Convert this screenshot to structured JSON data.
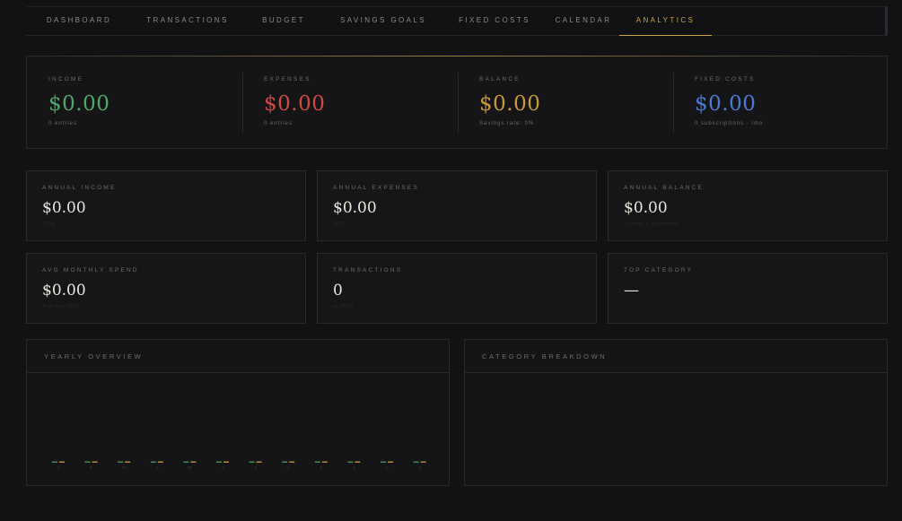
{
  "tabs": [
    {
      "label": "DASHBOARD"
    },
    {
      "label": "TRANSACTIONS"
    },
    {
      "label": "BUDGET"
    },
    {
      "label": "SAVINGS GOALS"
    },
    {
      "label": "FIXED COSTS"
    },
    {
      "label": "CALENDAR"
    },
    {
      "label": "ANALYTICS",
      "active": true
    }
  ],
  "summary": {
    "income": {
      "label": "INCOME",
      "value": "$0.00",
      "sub": "0 entries",
      "color": "#4fa76a"
    },
    "expenses": {
      "label": "EXPENSES",
      "value": "$0.00",
      "sub": "0 entries",
      "color": "#cf4a43"
    },
    "balance": {
      "label": "BALANCE",
      "value": "$0.00",
      "sub": "Savings rate: 0%",
      "color": "#c99a38"
    },
    "fixed": {
      "label": "FIXED COSTS",
      "value": "$0.00",
      "sub": "0 subscriptions · /mo",
      "color": "#4a7ad6"
    }
  },
  "cards": {
    "annual_income": {
      "label": "ANNUAL INCOME",
      "value": "$0.00",
      "sub": "2026"
    },
    "annual_expenses": {
      "label": "ANNUAL EXPENSES",
      "value": "$0.00",
      "sub": "2026"
    },
    "annual_balance": {
      "label": "ANNUAL BALANCE",
      "value": "$0.00",
      "sub": "Income − Expenses"
    },
    "avg_monthly": {
      "label": "AVG MONTHLY SPEND",
      "value": "$0.00",
      "sub": "Average 2026"
    },
    "transactions": {
      "label": "TRANSACTIONS",
      "value": "0",
      "sub": "in 2026"
    },
    "top_category": {
      "label": "TOP CATEGORY",
      "value": "—",
      "sub": ""
    }
  },
  "panels": {
    "yearly_title": "YEARLY OVERVIEW",
    "category_title": "CATEGORY BREAKDOWN"
  },
  "chart_data": {
    "type": "bar",
    "categories": [
      "J",
      "F",
      "M",
      "A",
      "M",
      "J",
      "J",
      "A",
      "S",
      "O",
      "N",
      "D"
    ],
    "series": [
      {
        "values": [
          0,
          0,
          0,
          0,
          0,
          0,
          0,
          0,
          0,
          0,
          0,
          0
        ],
        "color": "#3f8a58"
      },
      {
        "values": [
          0,
          0,
          0,
          0,
          0,
          0,
          0,
          0,
          0,
          0,
          0,
          0
        ],
        "color": "#b6893a"
      }
    ],
    "title": "YEARLY OVERVIEW",
    "xlabel": "",
    "ylabel": ""
  },
  "colors": {
    "accent": "#c9a645",
    "background": "#121214"
  }
}
